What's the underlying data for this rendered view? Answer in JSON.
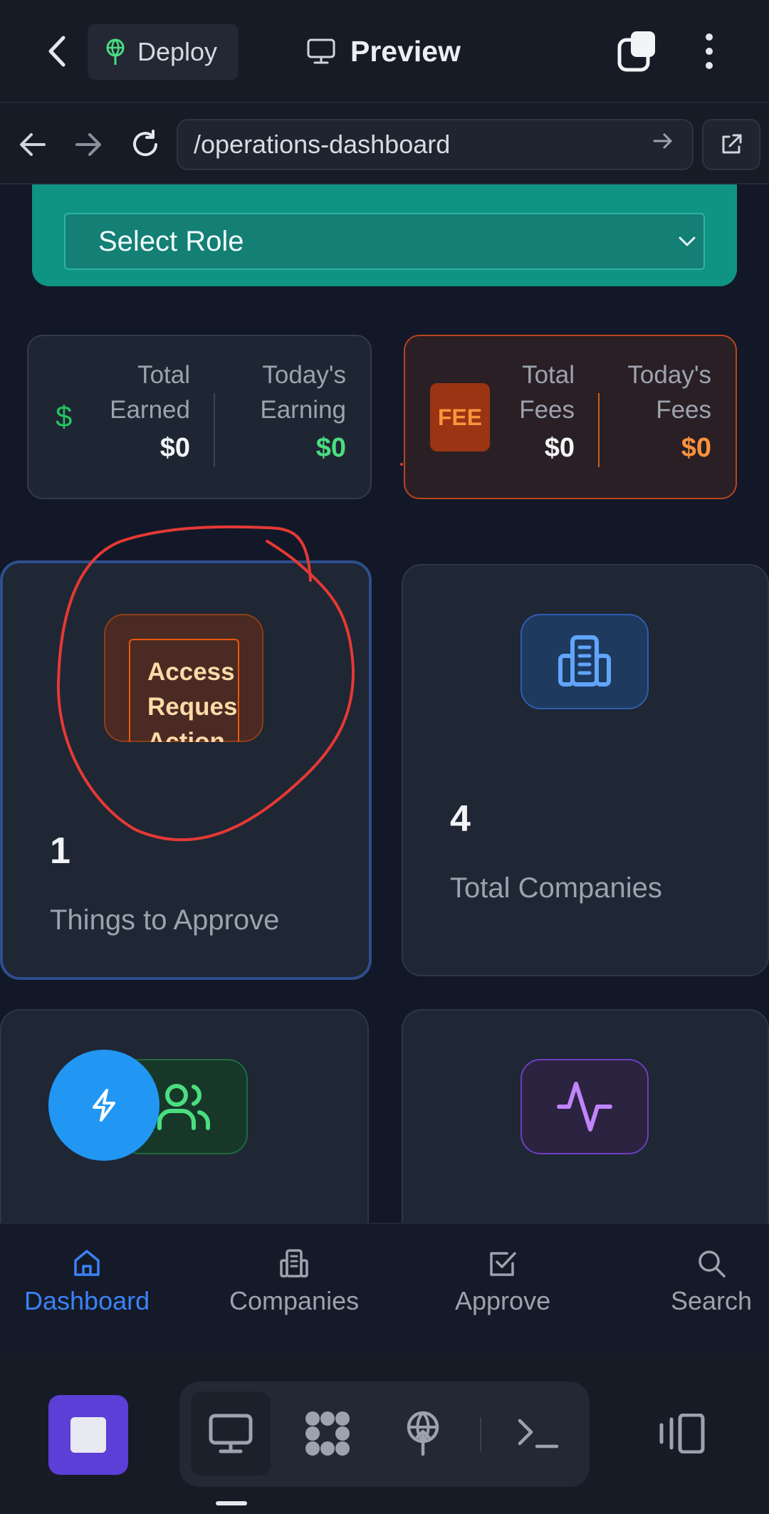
{
  "topbar": {
    "deploy_label": "Deploy",
    "preview_title": "Preview"
  },
  "urlbar": {
    "url": "/operations-dashboard"
  },
  "role": {
    "selected": "Select Role"
  },
  "stats": {
    "earned": {
      "total_label_1": "Total",
      "total_label_2": "Earned",
      "total_value": "$0",
      "today_label_1": "Today's",
      "today_label_2": "Earning",
      "today_value": "$0",
      "icon_glyph": "$"
    },
    "fees": {
      "badge": "FEE",
      "total_label_1": "Total",
      "total_label_2": "Fees",
      "total_value": "$0",
      "today_label_1": "Today's",
      "today_label_2": "Fees",
      "today_value": "$0"
    }
  },
  "tiles": {
    "approve": {
      "badge_line_1": "Access",
      "badge_line_2": "Request",
      "badge_line_3": "Action",
      "count": "1",
      "label": "Things to Approve"
    },
    "companies": {
      "count": "4",
      "label": "Total Companies",
      "icon": "building-icon"
    },
    "users": {
      "icon": "users-icon"
    },
    "activity": {
      "icon": "activity-icon"
    }
  },
  "bottom_nav": {
    "items": [
      {
        "label": "Dashboard",
        "icon": "home-icon",
        "active": true
      },
      {
        "label": "Companies",
        "icon": "building-icon",
        "active": false
      },
      {
        "label": "Approve",
        "icon": "check-square-icon",
        "active": false
      },
      {
        "label": "Search",
        "icon": "search-icon",
        "active": false
      }
    ]
  },
  "colors": {
    "accent": "#3b82f6",
    "role_card": "#0f9484",
    "earn_green": "#4ade80",
    "fee_orange": "#fb923c",
    "annotation": "#e53935"
  }
}
